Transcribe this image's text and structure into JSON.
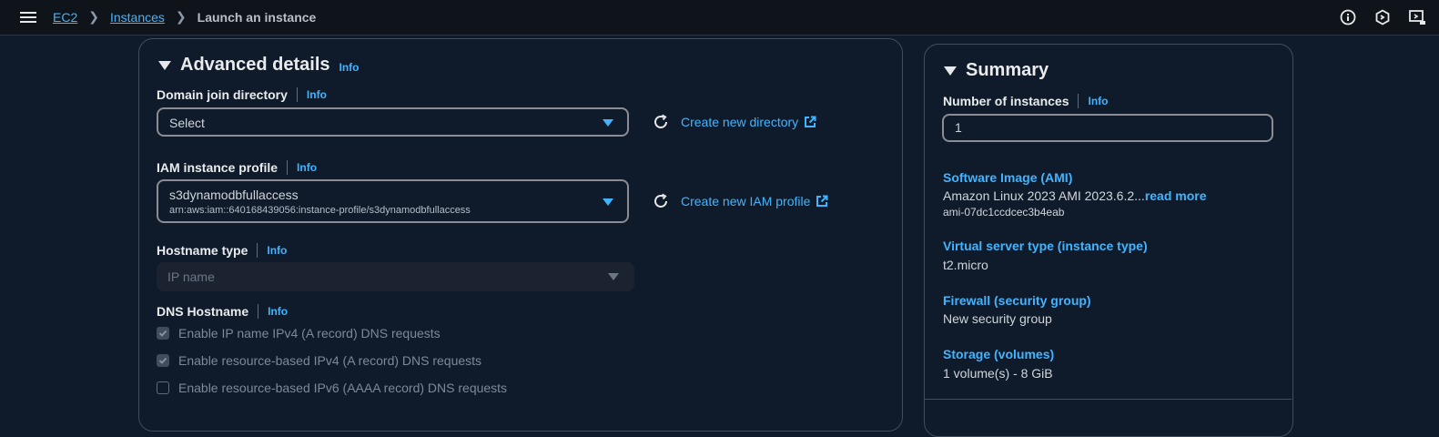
{
  "breadcrumb": {
    "items": [
      "EC2",
      "Instances"
    ],
    "current": "Launch an instance"
  },
  "advanced": {
    "title": "Advanced details",
    "info": "Info",
    "domain_join": {
      "label": "Domain join directory",
      "info": "Info",
      "value": "Select",
      "create_link": "Create new directory"
    },
    "iam_profile": {
      "label": "IAM instance profile",
      "info": "Info",
      "value": "s3dynamodbfullaccess",
      "arn": "arn:aws:iam::640168439056:instance-profile/s3dynamodbfullaccess",
      "create_link": "Create new IAM profile"
    },
    "hostname_type": {
      "label": "Hostname type",
      "info": "Info",
      "value": "IP name"
    },
    "dns_hostname": {
      "label": "DNS Hostname",
      "info": "Info",
      "options": [
        {
          "label": "Enable IP name IPv4 (A record) DNS requests",
          "checked": true
        },
        {
          "label": "Enable resource-based IPv4 (A record) DNS requests",
          "checked": true
        },
        {
          "label": "Enable resource-based IPv6 (AAAA record) DNS requests",
          "checked": false
        }
      ]
    }
  },
  "summary": {
    "title": "Summary",
    "num_instances_label": "Number of instances",
    "info": "Info",
    "num_instances_value": "1",
    "ami_title": "Software Image (AMI)",
    "ami_text": "Amazon Linux 2023 AMI 2023.6.2...",
    "ami_read_more": "read more",
    "ami_id": "ami-07dc1ccdcec3b4eab",
    "instance_type_title": "Virtual server type (instance type)",
    "instance_type_value": "t2.micro",
    "firewall_title": "Firewall (security group)",
    "firewall_value": "New security group",
    "storage_title": "Storage (volumes)",
    "storage_value": "1 volume(s) - 8 GiB"
  },
  "colors": {
    "link": "#42b4ff",
    "background": "#0f1b2a",
    "topbar": "#0f141a"
  }
}
